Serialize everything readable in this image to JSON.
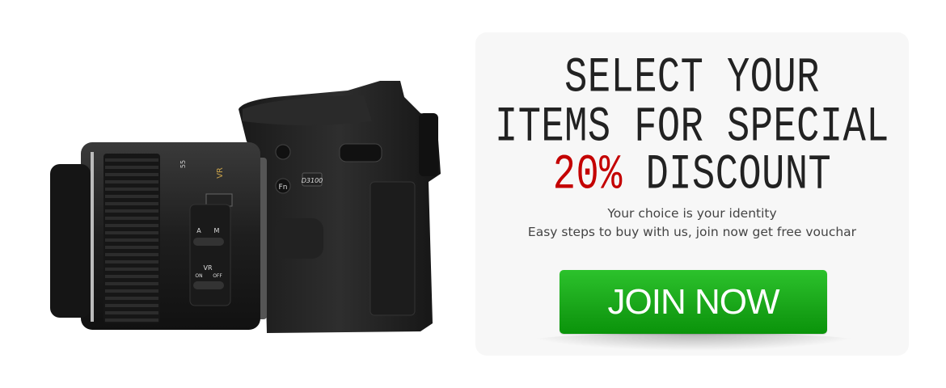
{
  "camera": {
    "labels": {
      "model": "D3100",
      "fn": "Fn",
      "vr": "VR",
      "a": "A",
      "m": "M",
      "vr2": "VR",
      "on": "ON",
      "off": "OFF",
      "focal": "55"
    }
  },
  "promo": {
    "headline_line1": "SELECT YOUR",
    "headline_line2": "ITEMS FOR SPECIAL",
    "discount_value": "20%",
    "discount_word": "DISCOUNT",
    "subtitle_line1": "Your choice is your identity",
    "subtitle_line2": "Easy steps to buy with us, join now get free vouchar",
    "cta_label": "JOIN NOW"
  },
  "colors": {
    "accent_red": "#c40000",
    "button_green": "#1fae1f",
    "panel_bg": "#f7f7f7"
  }
}
